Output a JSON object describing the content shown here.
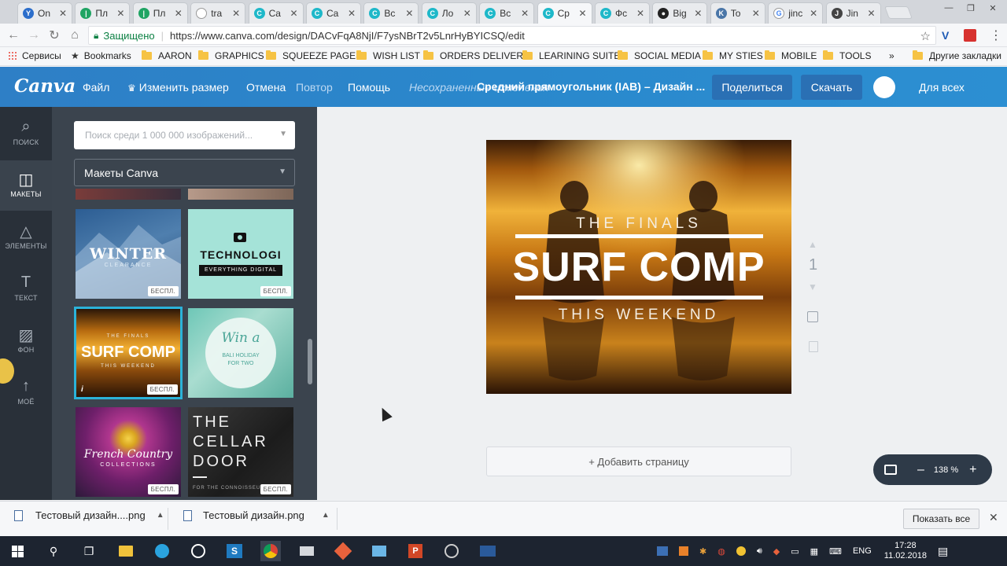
{
  "browser": {
    "tabs": [
      {
        "label": "On",
        "fav_color": "#2c6ecb",
        "fav_glyph": "Y",
        "active": false
      },
      {
        "label": "Пл",
        "fav_color": "#1fa463",
        "fav_glyph": "|",
        "active": false
      },
      {
        "label": "Пл",
        "fav_color": "#1fa463",
        "fav_glyph": "|",
        "active": false
      },
      {
        "label": "tra",
        "fav_color": "#ffffff",
        "fav_glyph": "",
        "active": false
      },
      {
        "label": "Ca",
        "fav_color": "#1eb8c9",
        "fav_glyph": "C",
        "active": false
      },
      {
        "label": "Ca",
        "fav_color": "#1eb8c9",
        "fav_glyph": "C",
        "active": false
      },
      {
        "label": "Вс",
        "fav_color": "#1eb8c9",
        "fav_glyph": "C",
        "active": false
      },
      {
        "label": "Ло",
        "fav_color": "#1eb8c9",
        "fav_glyph": "C",
        "active": false
      },
      {
        "label": "Вс",
        "fav_color": "#1eb8c9",
        "fav_glyph": "C",
        "active": false
      },
      {
        "label": "Ср",
        "fav_color": "#1eb8c9",
        "fav_glyph": "C",
        "active": true
      },
      {
        "label": "Фс",
        "fav_color": "#1eb8c9",
        "fav_glyph": "C",
        "active": false
      },
      {
        "label": "Big",
        "fav_color": "#222222",
        "fav_glyph": "●",
        "active": false
      },
      {
        "label": "To",
        "fav_color": "#4a76a8",
        "fav_glyph": "K",
        "active": false
      },
      {
        "label": "jinc",
        "fav_color": "#ffffff",
        "fav_glyph": "G",
        "active": false
      },
      {
        "label": "Jin",
        "fav_color": "#444444",
        "fav_glyph": "J",
        "active": false
      }
    ],
    "secure_label": "Защищено",
    "url": "https://www.canva.com/design/DACvFqA8NjI/F7ysNBrT2v5LnrHyBYICSQ/edit",
    "bookmarks": [
      "Сервисы",
      "Bookmarks",
      "AARON",
      "GRAPHICS",
      "SQUEEZE PAGES",
      "WISH LIST",
      "ORDERS DELIVERY",
      "LEARINING SUITE",
      "SOCIAL MEDIA",
      "MY STIES",
      "MOBILE",
      "TOOLS"
    ],
    "bookmarks_more": "»",
    "other_bookmarks": "Другие закладки"
  },
  "canva_header": {
    "logo": "Canva",
    "file": "Файл",
    "resize": "Изменить размер",
    "undo": "Отмена",
    "redo": "Повтор",
    "help": "Помощь",
    "unsaved": "Несохраненные изменения",
    "doc_title": "Средний прямоугольник (IAB) – Дизайн ...",
    "share": "Поделиться",
    "download": "Скачать",
    "visibility": "Для всех"
  },
  "rail": [
    {
      "label": "ПОИСК",
      "icon": "search-icon"
    },
    {
      "label": "МАКЕТЫ",
      "icon": "layouts-icon"
    },
    {
      "label": "ЭЛЕМЕНТЫ",
      "icon": "shapes-icon"
    },
    {
      "label": "ТЕКСТ",
      "icon": "text-icon"
    },
    {
      "label": "ФОН",
      "icon": "background-icon"
    },
    {
      "label": "МОЁ",
      "icon": "upload-icon"
    }
  ],
  "panel": {
    "search_placeholder": "Поиск среди 1 000 000 изображений...",
    "layout_select": "Макеты Canva",
    "badge": "БЕСПЛ.",
    "templates": {
      "winter_title": "WINTER",
      "winter_sub": "CLEARANCE",
      "tech_title": "TECHNOLOGI",
      "tech_sub": "EVERYTHING DIGITAL",
      "surf_title": "SURF COMP",
      "surf_top": "THE FINALS",
      "surf_bottom": "THIS WEEKEND",
      "win_title": "Win a",
      "win_sub": "BALI HOLIDAY FOR TWO",
      "french_title": "French Country",
      "french_sub": "COLLECTIONS",
      "cellar_l1": "THE",
      "cellar_l2": "CELLAR",
      "cellar_l3": "DOOR",
      "cellar_sub": "FOR THE CONNOISSEUR"
    }
  },
  "design": {
    "top": "THE FINALS",
    "title": "SURF COMP",
    "bottom": "THIS WEEKEND"
  },
  "canvas": {
    "page_number": "1",
    "add_page": "+ Добавить страницу",
    "zoom": "138 %"
  },
  "downloads": {
    "items": [
      "Тестовый дизайн....png",
      "Тестовый дизайн.png"
    ],
    "show_all": "Показать все"
  },
  "taskbar": {
    "lang": "ENG",
    "time": "17:28",
    "date": "11.02.2018"
  }
}
